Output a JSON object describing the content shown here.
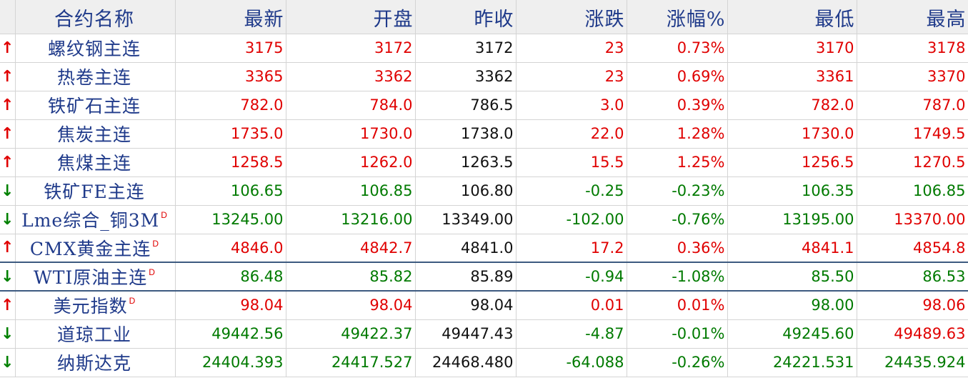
{
  "headers": {
    "name": "合约名称",
    "last": "最新",
    "open": "开盘",
    "prev": "昨收",
    "change": "涨跌",
    "pct": "涨幅%",
    "low": "最低",
    "high": "最高"
  },
  "colors": {
    "up": "#e00000",
    "down": "#007a00",
    "neutral": "#111111",
    "name": "#1f3a8a",
    "header_bg": "#efefef"
  },
  "icons": {
    "up": "arrow-up-icon",
    "down": "arrow-down-icon"
  },
  "rows": [
    {
      "dir": "up",
      "arrow": "↑",
      "name": "螺纹钢主连",
      "marker": "",
      "last": "3175",
      "open": "3172",
      "prev": "3172",
      "change": "23",
      "pct": "0.73%",
      "low": "3170",
      "high": "3178",
      "cls": {
        "last": "red",
        "open": "red",
        "prev": "black",
        "change": "red",
        "pct": "red",
        "low": "red",
        "high": "red"
      }
    },
    {
      "dir": "up",
      "arrow": "↑",
      "name": "热卷主连",
      "marker": "",
      "last": "3365",
      "open": "3362",
      "prev": "3362",
      "change": "23",
      "pct": "0.69%",
      "low": "3361",
      "high": "3370",
      "cls": {
        "last": "red",
        "open": "red",
        "prev": "black",
        "change": "red",
        "pct": "red",
        "low": "red",
        "high": "red"
      }
    },
    {
      "dir": "up",
      "arrow": "↑",
      "name": "铁矿石主连",
      "marker": "",
      "last": "782.0",
      "open": "784.0",
      "prev": "786.5",
      "change": "3.0",
      "pct": "0.39%",
      "low": "782.0",
      "high": "787.0",
      "cls": {
        "last": "red",
        "open": "red",
        "prev": "black",
        "change": "red",
        "pct": "red",
        "low": "red",
        "high": "red"
      }
    },
    {
      "dir": "up",
      "arrow": "↑",
      "name": "焦炭主连",
      "marker": "",
      "last": "1735.0",
      "open": "1730.0",
      "prev": "1738.0",
      "change": "22.0",
      "pct": "1.28%",
      "low": "1730.0",
      "high": "1749.5",
      "cls": {
        "last": "red",
        "open": "red",
        "prev": "black",
        "change": "red",
        "pct": "red",
        "low": "red",
        "high": "red"
      }
    },
    {
      "dir": "up",
      "arrow": "↑",
      "name": "焦煤主连",
      "marker": "",
      "last": "1258.5",
      "open": "1262.0",
      "prev": "1263.5",
      "change": "15.5",
      "pct": "1.25%",
      "low": "1256.5",
      "high": "1270.5",
      "cls": {
        "last": "red",
        "open": "red",
        "prev": "black",
        "change": "red",
        "pct": "red",
        "low": "red",
        "high": "red"
      }
    },
    {
      "dir": "down",
      "arrow": "↓",
      "name": "铁矿FE主连",
      "marker": "",
      "last": "106.65",
      "open": "106.85",
      "prev": "106.80",
      "change": "-0.25",
      "pct": "-0.23%",
      "low": "106.35",
      "high": "106.85",
      "cls": {
        "last": "green",
        "open": "green",
        "prev": "black",
        "change": "green",
        "pct": "green",
        "low": "green",
        "high": "green"
      }
    },
    {
      "dir": "down",
      "arrow": "↓",
      "name": "Lme综合_铜3M",
      "marker": "D",
      "last": "13245.00",
      "open": "13216.00",
      "prev": "13349.00",
      "change": "-102.00",
      "pct": "-0.76%",
      "low": "13195.00",
      "high": "13370.00",
      "cls": {
        "last": "green",
        "open": "green",
        "prev": "black",
        "change": "green",
        "pct": "green",
        "low": "green",
        "high": "red"
      }
    },
    {
      "dir": "up",
      "arrow": "↑",
      "name": "CMX黄金主连",
      "marker": "D",
      "last": "4846.0",
      "open": "4842.7",
      "prev": "4841.0",
      "change": "17.2",
      "pct": "0.36%",
      "low": "4841.1",
      "high": "4854.8",
      "cls": {
        "last": "red",
        "open": "red",
        "prev": "black",
        "change": "red",
        "pct": "red",
        "low": "red",
        "high": "red"
      }
    },
    {
      "dir": "down",
      "arrow": "↓",
      "name": "WTI原油主连",
      "marker": "D",
      "last": "86.48",
      "open": "85.82",
      "prev": "85.89",
      "change": "-0.94",
      "pct": "-1.08%",
      "low": "85.50",
      "high": "86.53",
      "selected": true,
      "cls": {
        "last": "green",
        "open": "green",
        "prev": "black",
        "change": "green",
        "pct": "green",
        "low": "green",
        "high": "green"
      }
    },
    {
      "dir": "up",
      "arrow": "↑",
      "name": "美元指数",
      "marker": "D",
      "last": "98.04",
      "open": "98.04",
      "prev": "98.04",
      "change": "0.01",
      "pct": "0.01%",
      "low": "98.00",
      "high": "98.06",
      "cls": {
        "last": "red",
        "open": "red",
        "prev": "black",
        "change": "red",
        "pct": "red",
        "low": "green",
        "high": "red"
      }
    },
    {
      "dir": "down",
      "arrow": "↓",
      "name": "道琼工业",
      "marker": "",
      "last": "49442.56",
      "open": "49422.37",
      "prev": "49447.43",
      "change": "-4.87",
      "pct": "-0.01%",
      "low": "49245.60",
      "high": "49489.63",
      "cls": {
        "last": "green",
        "open": "green",
        "prev": "black",
        "change": "green",
        "pct": "green",
        "low": "green",
        "high": "red"
      }
    },
    {
      "dir": "down",
      "arrow": "↓",
      "name": "纳斯达克",
      "marker": "",
      "last": "24404.393",
      "open": "24417.527",
      "prev": "24468.480",
      "change": "-64.088",
      "pct": "-0.26%",
      "low": "24221.531",
      "high": "24435.924",
      "cls": {
        "last": "green",
        "open": "green",
        "prev": "black",
        "change": "green",
        "pct": "green",
        "low": "green",
        "high": "green"
      }
    }
  ]
}
